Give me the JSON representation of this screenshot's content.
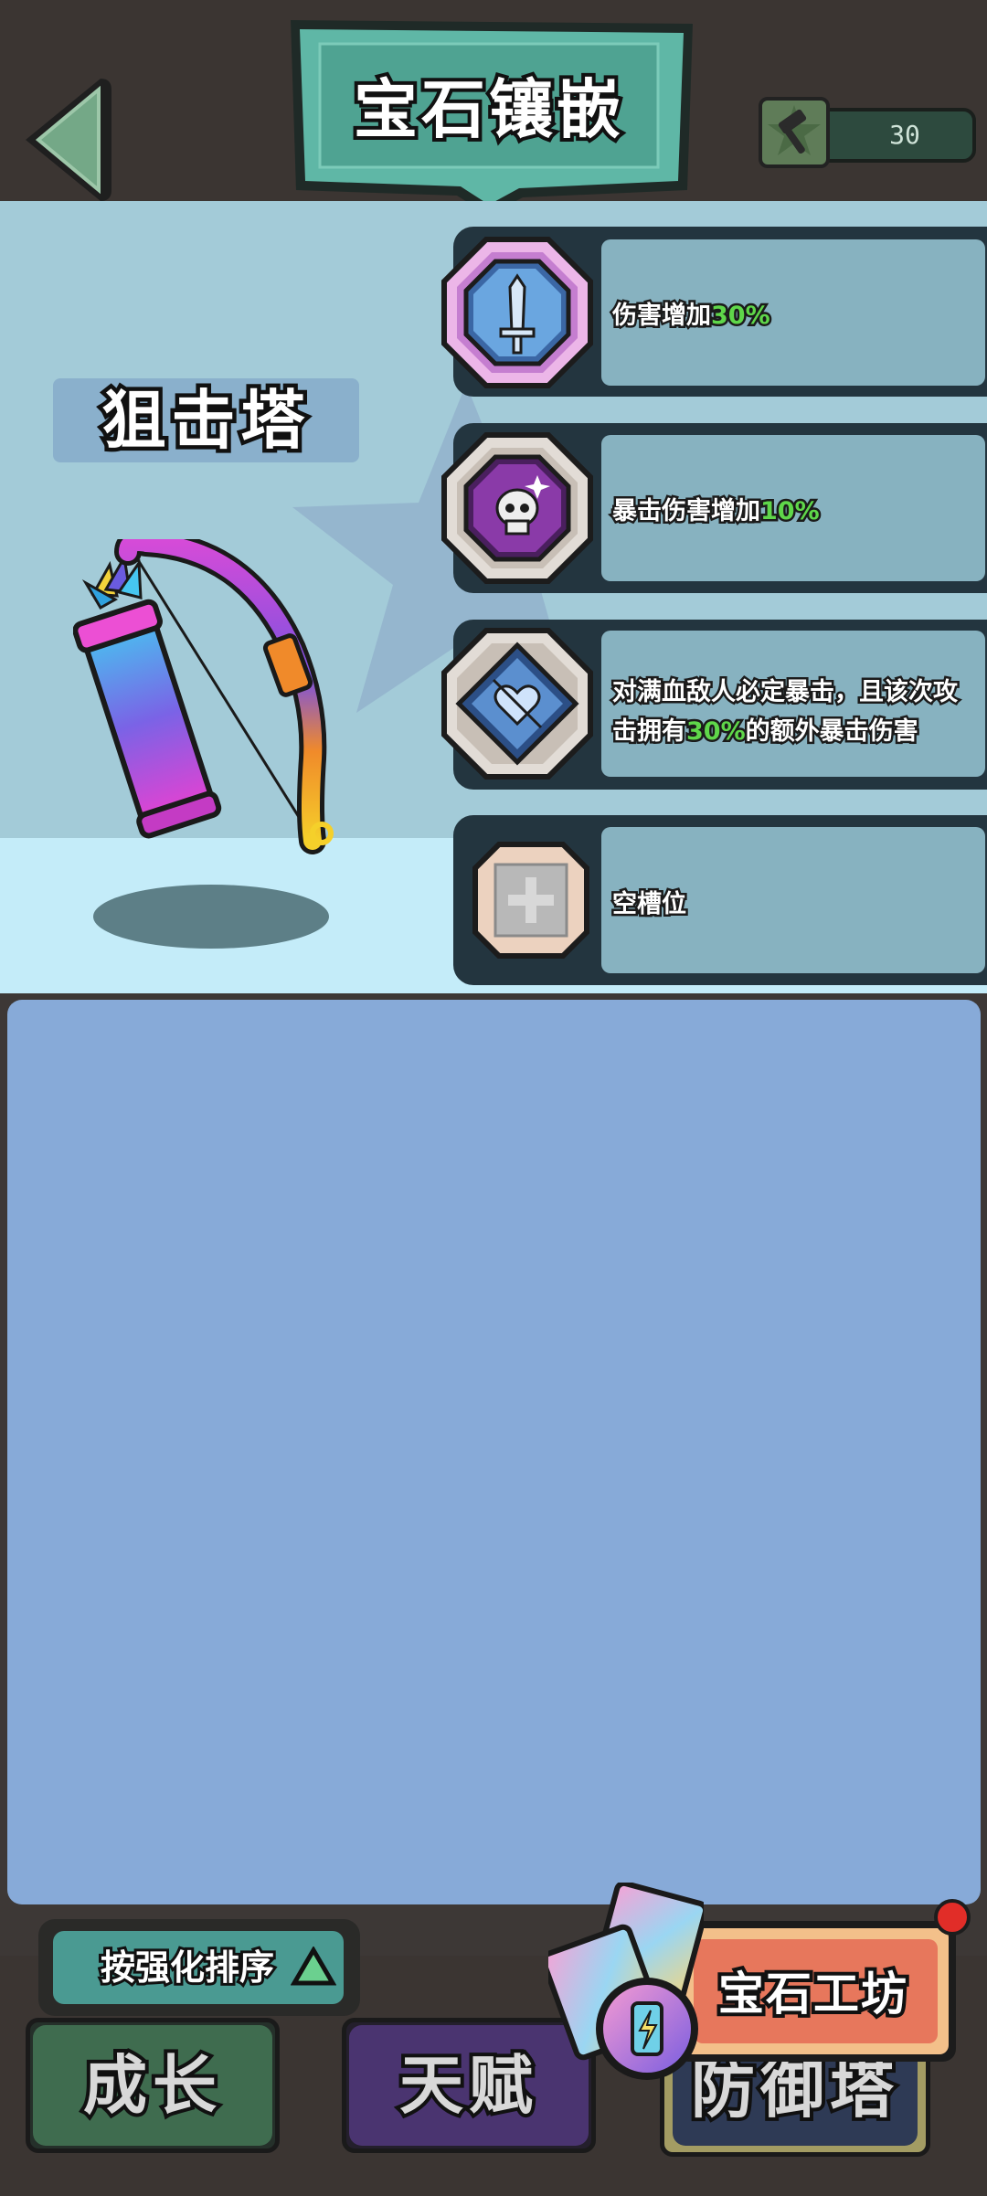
{
  "header": {
    "title": "宝石镶嵌",
    "hammer_count": "30"
  },
  "tower": {
    "name": "狙击塔"
  },
  "gem_slots": [
    {
      "icon": "sword-gem-icon",
      "text_before": "伤害增加",
      "highlight": "30%",
      "text_after": ""
    },
    {
      "icon": "skull-gem-icon",
      "text_before": "暴击伤害增加",
      "highlight": "10%",
      "text_after": ""
    },
    {
      "icon": "heart-gem-icon",
      "line1": "对满血敌人必定暴击，且该次攻",
      "line2_before": "击拥有",
      "highlight": "30%",
      "line2_after": "的额外暴击伤害"
    },
    {
      "icon": "plus-icon",
      "text": "空槽位"
    }
  ],
  "sort": {
    "label": "按强化排序"
  },
  "nav": {
    "tab_growth": "成长",
    "tab_talent": "天赋",
    "tab_tower": "防御塔"
  },
  "workshop": {
    "label": "宝石工坊"
  },
  "colors": {
    "accent_teal": "#4a9a92",
    "highlight_green": "#5fd74a",
    "inventory_bg": "#87aad8",
    "workshop_orange": "#e7775c",
    "notification_red": "#e12d28"
  }
}
